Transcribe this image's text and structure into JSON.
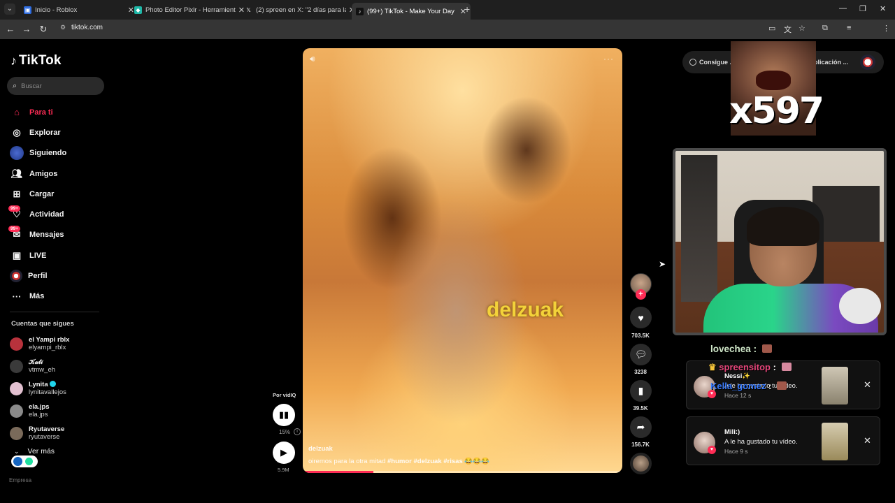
{
  "browser": {
    "tabs": [
      {
        "title": "Inicio - Roblox",
        "favicon_color": "#2f6de0",
        "active": false
      },
      {
        "title": "Photo Editor Pixlr - Herramienta",
        "favicon_color": "#1fb8a8",
        "active": false
      },
      {
        "title": "(2) spreen en X: \"2 días para la",
        "favicon_color": "#222222",
        "active": false
      },
      {
        "title": "(99+) TikTok - Make Your Day",
        "favicon_color": "#111111",
        "active": true
      }
    ],
    "url": "tiktok.com"
  },
  "sidebar": {
    "logo_text": "TikTok",
    "search_placeholder": "Buscar",
    "nav": [
      {
        "label": "Para ti",
        "icon": "home-icon",
        "active": true
      },
      {
        "label": "Explorar",
        "icon": "compass-icon"
      },
      {
        "label": "Siguiendo",
        "icon": "following-avatar-icon"
      },
      {
        "label": "Amigos",
        "icon": "friends-icon"
      },
      {
        "label": "Cargar",
        "icon": "upload-icon"
      },
      {
        "label": "Actividad",
        "icon": "activity-icon",
        "badge": "99+"
      },
      {
        "label": "Mensajes",
        "icon": "messages-icon",
        "badge": "99+"
      },
      {
        "label": "LIVE",
        "icon": "live-icon"
      },
      {
        "label": "Perfil",
        "icon": "profile-icon"
      },
      {
        "label": "Más",
        "icon": "more-icon"
      }
    ],
    "following_heading": "Cuentas que sigues",
    "following": [
      {
        "display": "el Yampi rblx",
        "user": "elyampi_rblx",
        "color": "#b8323c"
      },
      {
        "display": "𝒦𝒶𝓉𝒾",
        "user": "vtmw_eh",
        "color": "#3a3a3a"
      },
      {
        "display": "Lynita",
        "user": "lynitavallejos",
        "color": "#e2c0d0",
        "verified": true
      },
      {
        "display": "ela.jps",
        "user": "ela.jps",
        "color": "#8a8a8a"
      },
      {
        "display": "Ryutaverse",
        "user": "ryutaverse",
        "color": "#7a6a5a"
      }
    ],
    "ver_mas": "Ver más",
    "footer_text": "Empresa"
  },
  "video": {
    "overlay_text": "delzuak",
    "author": "delzuak",
    "caption_text": "oiremos para la otra mitad",
    "hashtags": [
      "#humor",
      "#delzuak",
      "#risas"
    ],
    "caption_emoji": "😂😂😂",
    "progress": 0.22
  },
  "vidiq": {
    "label": "Por vidIQ",
    "percent": "15%",
    "views": "5.9M"
  },
  "actions": {
    "likes": "703.5K",
    "comments": "3238",
    "saves": "39.5K",
    "shares": "156.7K"
  },
  "topbar": {
    "consigue_text": "Consigue ...",
    "app_text": "plicación ..."
  },
  "stream": {
    "meme_text": "x597",
    "chat": [
      {
        "user": "lovechea",
        "text": ":"
      },
      {
        "user": "spreensitop",
        "text": ":"
      },
      {
        "user": "Kella_gomez",
        "text": ":"
      }
    ]
  },
  "notifications": [
    {
      "name": "Nessi✨",
      "message": "A le ha gustado tu vídeo.",
      "time": "Hace 12 s"
    },
    {
      "name": "Mili:)",
      "message": "A le ha gustado tu vídeo.",
      "time": "Hace 9 s"
    }
  ]
}
